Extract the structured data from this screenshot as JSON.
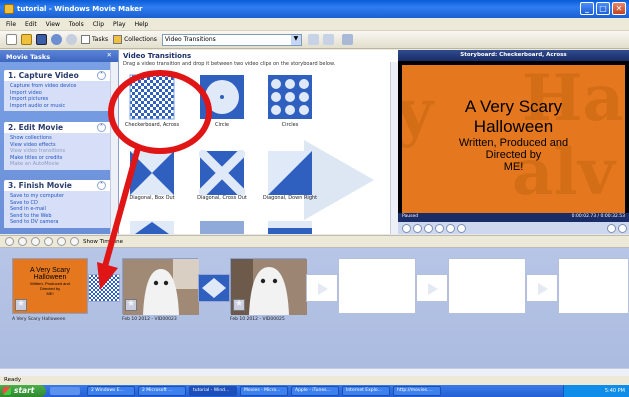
{
  "window": {
    "title": "tutorial - Windows Movie Maker"
  },
  "menu": [
    "File",
    "Edit",
    "View",
    "Tools",
    "Clip",
    "Play",
    "Help"
  ],
  "toolbar": {
    "tasks": "Tasks",
    "collections": "Collections",
    "combo_value": "Video Transitions"
  },
  "taskpane": {
    "title": "Movie Tasks",
    "sections": [
      {
        "title": "1. Capture Video",
        "items": [
          "Capture from video device",
          "Import video",
          "Import pictures",
          "Import audio or music"
        ]
      },
      {
        "title": "2. Edit Movie",
        "items": [
          "Show collections",
          "View video effects",
          "View video transitions",
          "Make titles or credits",
          "Make an AutoMovie"
        ]
      },
      {
        "title": "3. Finish Movie",
        "items": [
          "Save to my computer",
          "Save to CD",
          "Send in e-mail",
          "Send to the Web",
          "Send to DV camera"
        ]
      }
    ]
  },
  "transitions": {
    "title": "Video Transitions",
    "description": "Drag a video transition and drop it between two video clips on the storyboard below.",
    "items": [
      {
        "label": "Checkerboard, Across",
        "icon": "checkerboard-icon"
      },
      {
        "label": "Circle",
        "icon": "circle-icon"
      },
      {
        "label": "Circles",
        "icon": "circles-icon"
      },
      {
        "label": "Diagonal, Box Out",
        "icon": "diagonal-box-out-icon"
      },
      {
        "label": "Diagonal, Cross Out",
        "icon": "diagonal-cross-out-icon"
      },
      {
        "label": "Diagonal, Down Right",
        "icon": "diagonal-down-right-icon"
      }
    ]
  },
  "preview": {
    "title": "Storyboard: Checkerboard, Across",
    "line1": "A Very Scary",
    "line2": "Halloween",
    "line3": "Written, Produced and",
    "line4": "Directed by",
    "line5": "ME!",
    "status": "Paused",
    "time": "0:00:02.73 / 0:00:32.53"
  },
  "storyboard": {
    "show_timeline": "Show Timeline",
    "clips": [
      {
        "label": "A Very Scary Halloween",
        "title_lines": [
          "A Very Scary",
          "Halloween",
          "Written, Produced and",
          "Directed by",
          "ME!"
        ]
      },
      {
        "label": "Feb 10 2012 - VID00023"
      },
      {
        "label": "Feb 10 2012 - VID00025"
      }
    ]
  },
  "status": {
    "text": "Ready"
  },
  "taskbar": {
    "start": "start",
    "tasks": [
      "2 Windows E...",
      "2 Microsoft ...",
      "tutorial - Wind...",
      "Movies - Micro...",
      "Apple - iTunes...",
      "Internet Explo...",
      "http://movies...."
    ],
    "clock": "5:40 PM"
  },
  "colors": {
    "annotation": "#e01515",
    "preview_bg": "#e5781e",
    "titlebar": "#1b5fd0"
  }
}
